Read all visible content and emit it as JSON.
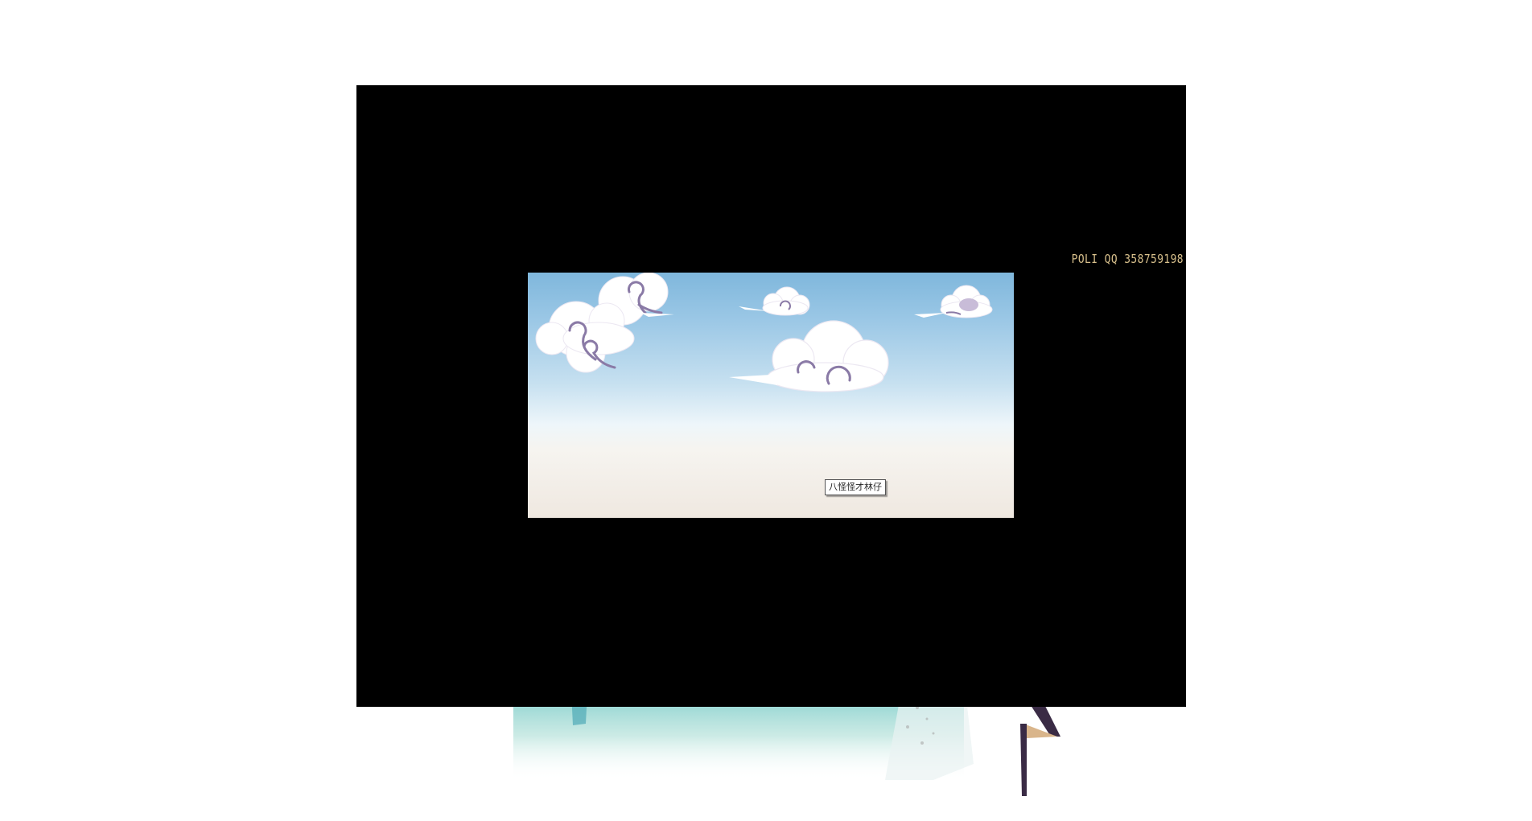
{
  "stage": {
    "credit_text": "POLI  QQ  358759198",
    "tooltip_text": "八怪怪才林仔"
  },
  "colors": {
    "stage_background": "#000000",
    "credit_text": "#d8c08c",
    "sky_top": "#7fb7dc",
    "sky_bottom": "#efe8e0",
    "cloud_fill": "#ffffff",
    "cloud_swirl": "#8a7aa6",
    "page_background": "#ffffff"
  },
  "icons": [
    "cloud-icon"
  ]
}
